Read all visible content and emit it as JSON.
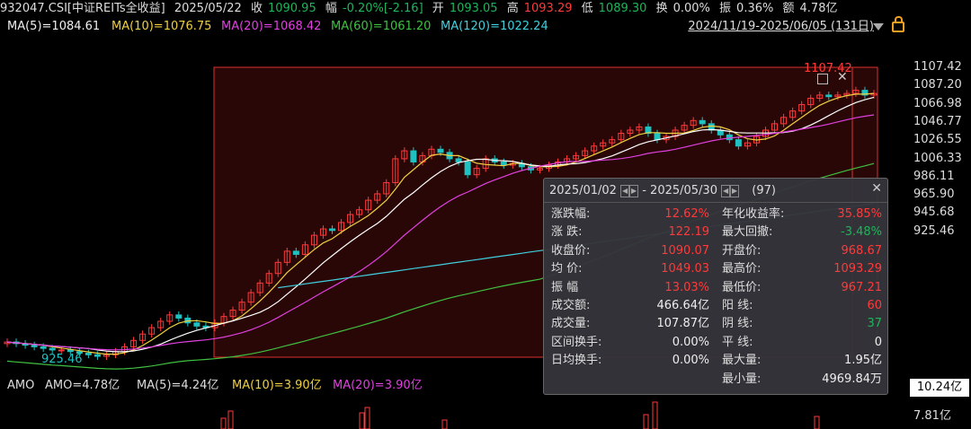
{
  "header": {
    "code": "932047.CSI[中证REITs全收益]",
    "date": "2025/05/22",
    "close_label": "收",
    "close_value": "1090.95",
    "change_label": "幅",
    "change_value": "-0.20%[-2.16]",
    "open_label": "开",
    "open_value": "1093.05",
    "high_label": "高",
    "high_value": "1093.29",
    "low_label": "低",
    "low_value": "1089.30",
    "turnover_label": "换",
    "turnover_value": "0.00%",
    "amplitude_label": "振",
    "amplitude_value": "0.36%",
    "amount_label": "额",
    "amount_value": "4.78亿"
  },
  "ma": {
    "ma5": "MA(5)=1084.61",
    "ma10": "MA(10)=1076.75",
    "ma20": "MA(20)=1068.42",
    "ma60": "MA(60)=1061.20",
    "ma120": "MA(120)=1022.24"
  },
  "period_range": "2024/11/19-2025/06/05 (131日)",
  "price_axis": [
    "1107.42",
    "1087.20",
    "1066.98",
    "1046.77",
    "1026.55",
    "1006.33",
    "986.11",
    "965.90",
    "945.68",
    "925.46"
  ],
  "annotations": {
    "high_mark": "1107.42",
    "low_mark": "925.46"
  },
  "amo": {
    "label": "AMO",
    "amo": "AMO=4.78亿",
    "ma5": "MA(5)=4.24亿",
    "ma10": "MA(10)=3.90亿",
    "ma20": "MA(20)=3.90亿",
    "current": "10.24亿",
    "tick": "7.81亿"
  },
  "stats": {
    "start_date": "2025/01/02",
    "end_date": "2025/05/30",
    "days": "(97)",
    "close_icon": "close-icon",
    "left": [
      {
        "label": "涨跌幅:",
        "value": "12.62%",
        "color": "red"
      },
      {
        "label": "涨  跌:",
        "value": "122.19",
        "color": "red"
      },
      {
        "label": "收盘价:",
        "value": "1090.07",
        "color": "red"
      },
      {
        "label": "均  价:",
        "value": "1049.03",
        "color": "red"
      },
      {
        "label": "振  幅",
        "value": "13.03%",
        "color": "red"
      },
      {
        "label": "成交额:",
        "value": "466.64亿",
        "color": "white"
      },
      {
        "label": "成交量:",
        "value": "107.87亿",
        "color": "white"
      },
      {
        "label": "区间换手:",
        "value": "0.00%",
        "color": "white"
      },
      {
        "label": "日均换手:",
        "value": "0.00%",
        "color": "white"
      }
    ],
    "right": [
      {
        "label": "年化收益率:",
        "value": "35.85%",
        "color": "red"
      },
      {
        "label": "最大回撤:",
        "value": "-3.48%",
        "color": "green"
      },
      {
        "label": "开盘价:",
        "value": "968.67",
        "color": "red"
      },
      {
        "label": "最高价:",
        "value": "1093.29",
        "color": "red"
      },
      {
        "label": "最低价:",
        "value": "967.21",
        "color": "red"
      },
      {
        "label": "阳  线:",
        "value": "60",
        "color": "red"
      },
      {
        "label": "阴  线:",
        "value": "37",
        "color": "green"
      },
      {
        "label": "平  线:",
        "value": "0",
        "color": "white"
      },
      {
        "label": "最大量:",
        "value": "1.95亿",
        "color": "white"
      },
      {
        "label": "最小量:",
        "value": "4969.84万",
        "color": "white"
      }
    ]
  },
  "colors": {
    "up": "#ff3a3a",
    "down": "#1fc1c1",
    "ma5": "#ffffff",
    "ma10": "#f0d040",
    "ma20": "#e040e0",
    "ma60": "#40c040",
    "ma120": "#40d0e0",
    "selection": "#e03030"
  },
  "chart_data": {
    "type": "candlestick",
    "ylim": [
      925.46,
      1107.42
    ],
    "close_series": [
      935,
      934,
      933,
      932,
      931,
      930,
      930,
      929,
      928,
      927,
      926,
      927,
      929,
      932,
      936,
      940,
      944,
      948,
      952,
      950,
      947,
      945,
      944,
      947,
      951,
      955,
      960,
      966,
      972,
      978,
      985,
      992,
      990,
      996,
      1002,
      1006,
      1005,
      1010,
      1015,
      1018,
      1024,
      1028,
      1035,
      1050,
      1055,
      1048,
      1052,
      1056,
      1054,
      1050,
      1048,
      1040,
      1044,
      1050,
      1048,
      1046,
      1047,
      1045,
      1043,
      1044,
      1046,
      1048,
      1050,
      1052,
      1055,
      1058,
      1060,
      1062,
      1066,
      1068,
      1070,
      1066,
      1062,
      1064,
      1068,
      1071,
      1074,
      1072,
      1068,
      1065,
      1062,
      1058,
      1060,
      1064,
      1068,
      1072,
      1076,
      1080,
      1084,
      1088,
      1090,
      1089,
      1090,
      1091,
      1093,
      1090,
      1091
    ]
  }
}
